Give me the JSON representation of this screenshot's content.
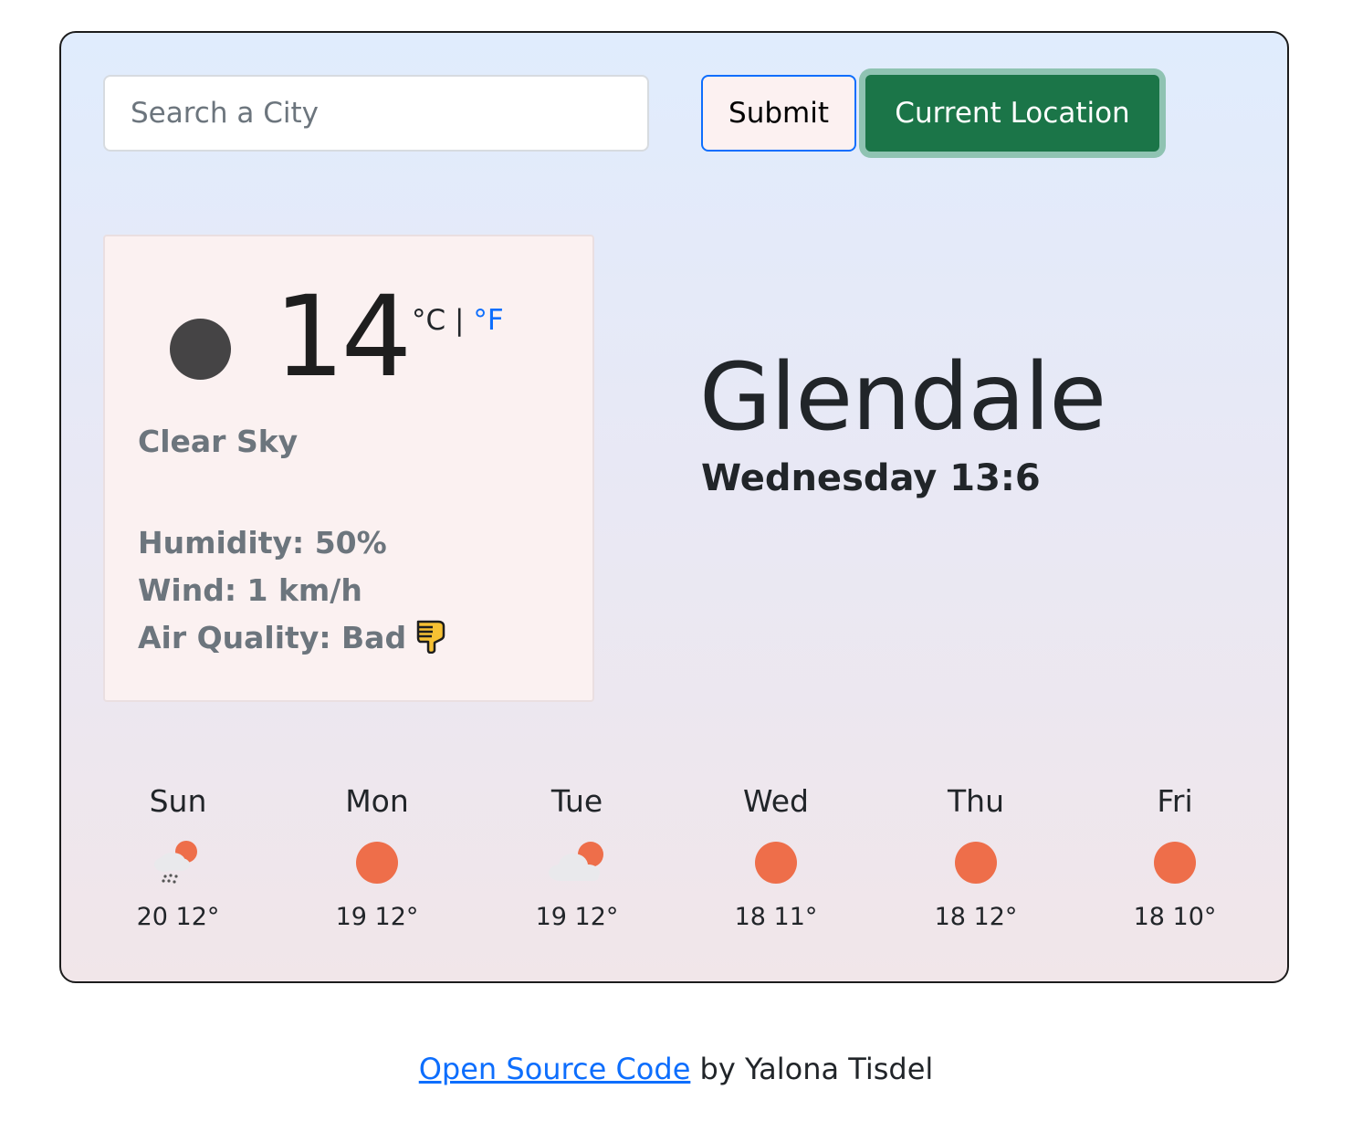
{
  "search": {
    "placeholder": "Search a City",
    "value": ""
  },
  "buttons": {
    "submit": "Submit",
    "current_location": "Current Location"
  },
  "current": {
    "temperature": "14",
    "unit_celsius": "°C",
    "unit_separator": "|",
    "unit_fahrenheit": "°F",
    "description": "Clear Sky",
    "humidity": "Humidity: 50%",
    "wind": "Wind: 1 km/h",
    "air_quality": "Air Quality: Bad",
    "icon": "dark-circle-icon",
    "air_quality_icon": "thumbs-down-icon"
  },
  "location": {
    "city": "Glendale",
    "datetime": "Wednesday 13:6"
  },
  "forecast": [
    {
      "day": "Sun",
      "temps": "20 12°",
      "icon": "rain-cloud-sun-icon"
    },
    {
      "day": "Mon",
      "temps": "19 12°",
      "icon": "sun-icon"
    },
    {
      "day": "Tue",
      "temps": "19 12°",
      "icon": "cloud-sun-icon"
    },
    {
      "day": "Wed",
      "temps": "18 11°",
      "icon": "sun-icon"
    },
    {
      "day": "Thu",
      "temps": "18 12°",
      "icon": "sun-icon"
    },
    {
      "day": "Fri",
      "temps": "18 10°",
      "icon": "sun-icon"
    }
  ],
  "footer": {
    "link_text": "Open Source Code",
    "suffix": " by Yalona Tisdel"
  },
  "colors": {
    "primary": "#0d6efd",
    "success": "#1b7548",
    "sun": "#ee6e4a",
    "muted": "#6c757d"
  }
}
